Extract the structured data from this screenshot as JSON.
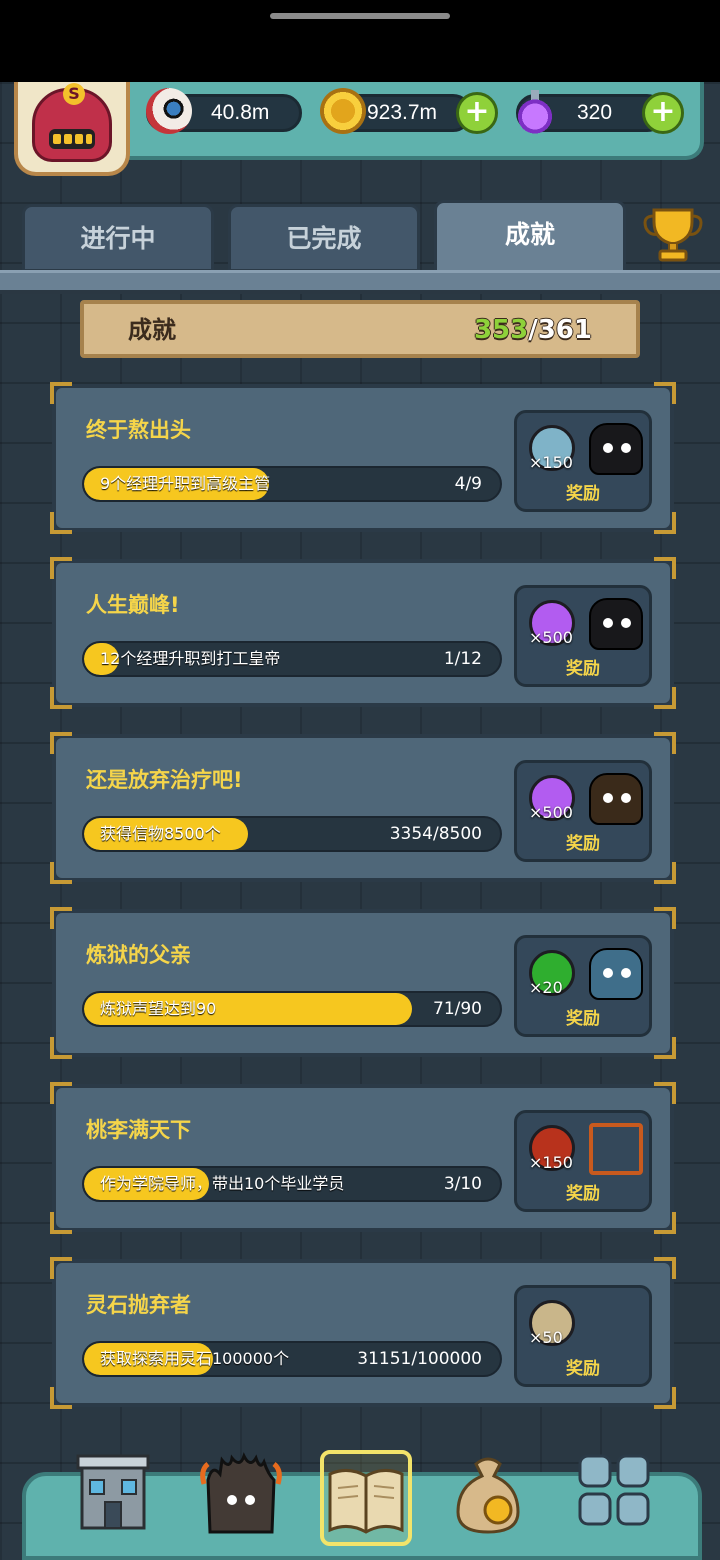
{
  "resources": {
    "eye": {
      "value": "40.8m",
      "icon": "eyeball-icon"
    },
    "coin": {
      "value": "923.7m",
      "icon": "coin-icon"
    },
    "potion": {
      "value": "320",
      "icon": "potion-icon"
    }
  },
  "avatar": {
    "badge": "S"
  },
  "tabs": [
    {
      "label": "进行中",
      "active": false
    },
    {
      "label": "已完成",
      "active": false
    },
    {
      "label": "成就",
      "active": true
    }
  ],
  "summary": {
    "title": "成就",
    "done": "353",
    "separator": "/",
    "total": "361"
  },
  "achievements": [
    {
      "title": "终于熬出头",
      "task": "9个经理升职到高级主管",
      "progress": "4/9",
      "fraction": 0.444,
      "reward_qty": "×150",
      "reward_label": "奖励",
      "reward_icon": "spiked-orb-icon",
      "reward_color": "#7fb3c8",
      "char_color": "#18181b"
    },
    {
      "title": "人生巅峰!",
      "task": "12个经理升职到打工皇帝",
      "progress": "1/12",
      "fraction": 0.083,
      "reward_qty": "×500",
      "reward_label": "奖励",
      "reward_icon": "potion-icon",
      "reward_color": "#b25cf0",
      "char_color": "#18181b"
    },
    {
      "title": "还是放弃治疗吧!",
      "task": "获得信物8500个",
      "progress": "3354/8500",
      "fraction": 0.395,
      "reward_qty": "×500",
      "reward_label": "奖励",
      "reward_icon": "potion-icon",
      "reward_color": "#b25cf0",
      "char_color": "#3a2a1a"
    },
    {
      "title": "炼狱的父亲",
      "task": "炼狱声望达到90",
      "progress": "71/90",
      "fraction": 0.789,
      "reward_qty": "×20",
      "reward_label": "奖励",
      "reward_icon": "emerald-icon",
      "reward_color": "#2fae2f",
      "char_color": "#3f6e8a"
    },
    {
      "title": "桃李满天下",
      "task": "作为学院导师，带出10个毕业学员",
      "progress": "3/10",
      "fraction": 0.3,
      "reward_qty": "×150",
      "reward_label": "奖励",
      "reward_icon": "blood-drop-icon",
      "reward_color": "#b8321c",
      "char_color": "transparent"
    },
    {
      "title": "灵石抛弃者",
      "task": "获取探索用灵石100000个",
      "progress": "31151/100000",
      "fraction": 0.311,
      "reward_qty": "×50",
      "reward_label": "奖励",
      "reward_icon": "map-scroll-icon",
      "reward_color": "#c9b68a",
      "char_color": "none"
    }
  ],
  "nav": [
    {
      "name": "building-icon",
      "active": false
    },
    {
      "name": "monster-icon",
      "active": false
    },
    {
      "name": "book-icon",
      "active": true
    },
    {
      "name": "money-bag-icon",
      "active": false
    },
    {
      "name": "grid-menu-icon",
      "active": false
    }
  ]
}
